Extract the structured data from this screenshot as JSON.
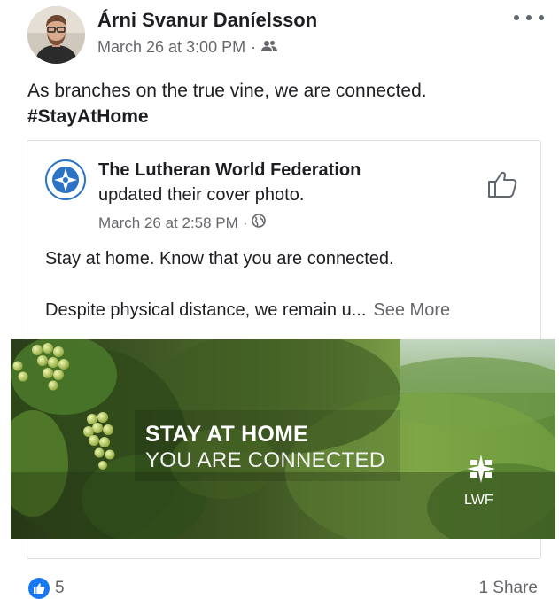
{
  "post": {
    "author": "Árni Svanur Daníelsson",
    "timestamp": "March 26 at 3:00 PM",
    "separator": "·",
    "audience_icon": "friends-icon",
    "text": "As branches on the true vine, we are connected.",
    "hashtag": "#StayAtHome"
  },
  "shared_post": {
    "page_name": "The Lutheran World Federation",
    "action": "updated their cover photo.",
    "timestamp": "March 26 at 2:58 PM",
    "separator": "·",
    "audience_icon": "globe-icon",
    "line1": "Stay at home. Know that you are connected.",
    "line2": "Despite physical distance, we remain u...",
    "see_more": "See More"
  },
  "cover_photo": {
    "title": "STAY AT HOME",
    "subtitle": "YOU ARE CONNECTED",
    "logo_text": "LWF"
  },
  "footer": {
    "reaction_count": "5",
    "shares": "1 Share"
  },
  "colors": {
    "accent": "#1877f2",
    "secondary_text": "#65676b",
    "border": "#dddfe2"
  }
}
